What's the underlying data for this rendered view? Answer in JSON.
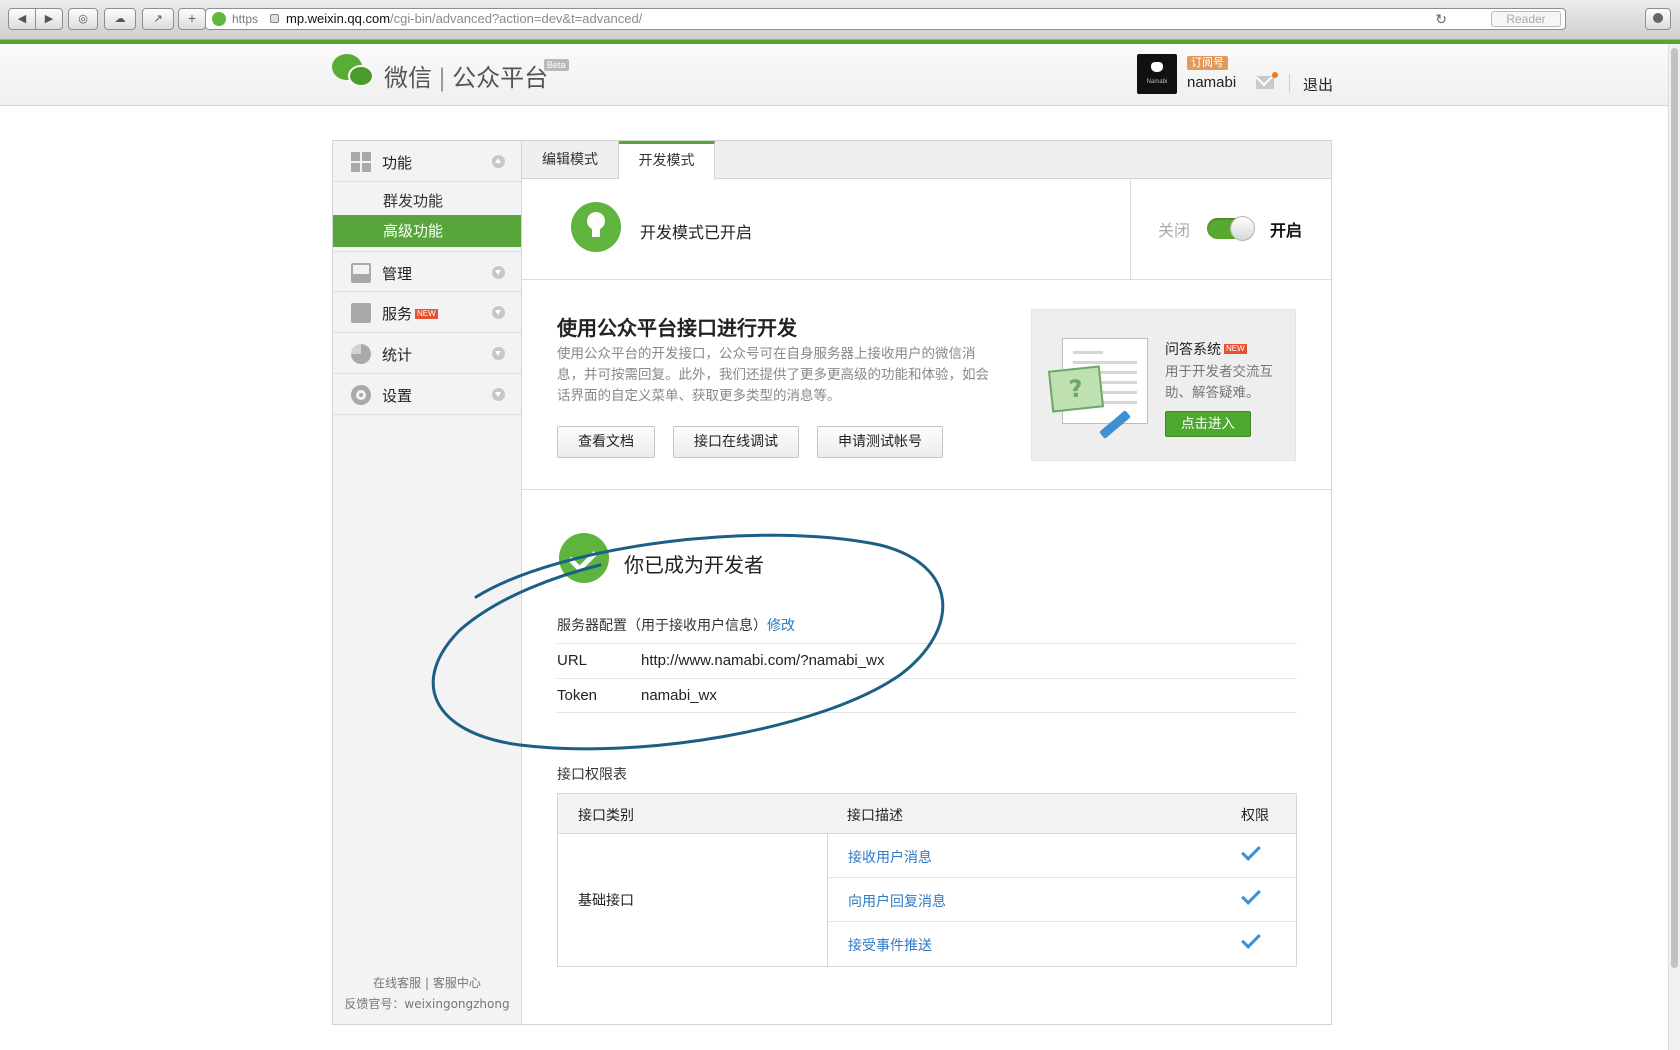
{
  "browser": {
    "protocol": "https",
    "domain": "mp.weixin.qq.com",
    "path": "/cgi-bin/advanced?action=dev&t=advanced/",
    "reader_label": "Reader"
  },
  "header": {
    "brand": "微信",
    "product": "公众平台",
    "beta": "Beta",
    "account_type": "订阅号",
    "account_name": "namabi",
    "avatar_text": "Namabi",
    "logout": "退出"
  },
  "sidebar": {
    "groups": [
      {
        "label": "功能",
        "icon": "grid-icon",
        "expanded": true
      },
      {
        "label": "管理",
        "icon": "tray-icon"
      },
      {
        "label": "服务",
        "icon": "printer-icon",
        "badge": "NEW"
      },
      {
        "label": "统计",
        "icon": "pie-chart-icon"
      },
      {
        "label": "设置",
        "icon": "gear-icon"
      }
    ],
    "subitems": [
      {
        "label": "群发功能"
      },
      {
        "label": "高级功能",
        "active": true
      }
    ],
    "footer_line1_a": "在线客服",
    "footer_line1_b": "客服中心",
    "footer_line2": "反馈官号：weixingongzhong"
  },
  "tabs": {
    "edit": "编辑模式",
    "dev": "开发模式"
  },
  "status": {
    "text": "开发模式已开启",
    "off_label": "关闭",
    "on_label": "开启",
    "enabled": true
  },
  "intro": {
    "title": "使用公众平台接口进行开发",
    "description": "使用公众平台的开发接口，公众号可在自身服务器上接收用户的微信消息，并可按需回复。此外，我们还提供了更多更高级的功能和体验，如会话界面的自定义菜单、获取更多类型的消息等。",
    "buttons": {
      "docs": "查看文档",
      "debug": "接口在线调试",
      "test_account": "申请测试帐号"
    }
  },
  "qa": {
    "title": "问答系统",
    "badge": "NEW",
    "description": "用于开发者交流互助、解答疑难。",
    "button": "点击进入"
  },
  "developer": {
    "title": "你已成为开发者",
    "config_heading": "服务器配置（用于接收用户信息）",
    "edit": "修改",
    "url_label": "URL",
    "url_value": "http://www.namabi.com/?namabi_wx",
    "token_label": "Token",
    "token_value": "namabi_wx"
  },
  "permissions": {
    "title": "接口权限表",
    "headers": {
      "category": "接口类别",
      "description": "接口描述",
      "permission": "权限"
    },
    "category": "基础接口",
    "rows": [
      {
        "name": "接收用户消息",
        "granted": true
      },
      {
        "name": "向用户回复消息",
        "granted": true
      },
      {
        "name": "接受事件推送",
        "granted": true
      }
    ]
  },
  "colors": {
    "brand_green": "#58a53c",
    "link_blue": "#2e7ac4",
    "annotation_stroke": "#1c5f85"
  }
}
